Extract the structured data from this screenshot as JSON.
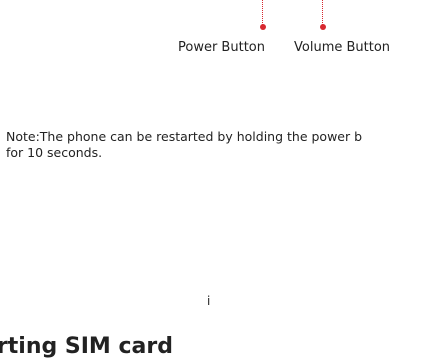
{
  "callouts": {
    "power_label": "Power Button",
    "volume_label": "Volume Button",
    "accent_color": "#d7282f"
  },
  "note": {
    "line1": "Note:The phone can be restarted by holding the power b",
    "line2": "for 10 seconds."
  },
  "page_number": "i",
  "section_heading": "erting SIM card"
}
